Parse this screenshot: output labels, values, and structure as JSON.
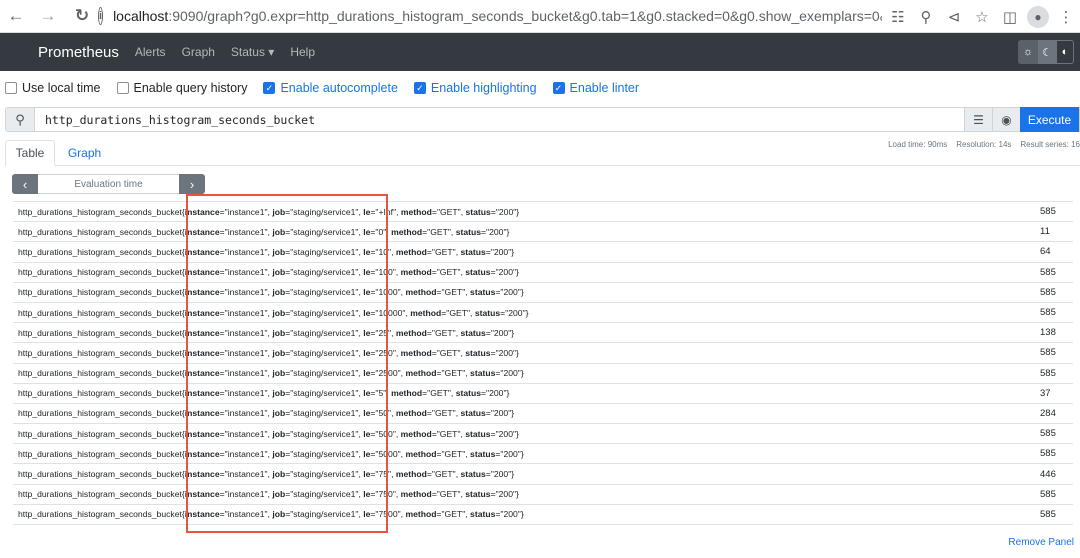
{
  "browser": {
    "url_host": "localhost",
    "url_rest": ":9090/graph?g0.expr=http_durations_histogram_seconds_bucket&g0.tab=1&g0.stacked=0&g0.show_exemplars=0&g0.ran…"
  },
  "navbar": {
    "brand": "Prometheus",
    "links": [
      "Alerts",
      "Graph",
      "Status",
      "Help"
    ]
  },
  "options": [
    {
      "label": "Use local time",
      "checked": false
    },
    {
      "label": "Enable query history",
      "checked": false
    },
    {
      "label": "Enable autocomplete",
      "checked": true
    },
    {
      "label": "Enable highlighting",
      "checked": true
    },
    {
      "label": "Enable linter",
      "checked": true
    }
  ],
  "query": {
    "expression": "http_durations_histogram_seconds_bucket",
    "execute_label": "Execute"
  },
  "tabs": {
    "table": "Table",
    "graph": "Graph"
  },
  "stats": {
    "load_time": "Load time: 90ms",
    "resolution": "Resolution: 14s",
    "result_series": "Result series: 16"
  },
  "eval": {
    "placeholder": "Evaluation time"
  },
  "results": {
    "metric_name": "http_durations_histogram_seconds_bucket",
    "instance": "instance1",
    "job": "staging/service1",
    "method": "GET",
    "status": "200",
    "rows": [
      {
        "le": "+Inf",
        "value": "585"
      },
      {
        "le": "0",
        "value": "11"
      },
      {
        "le": "10",
        "value": "64"
      },
      {
        "le": "100",
        "value": "585"
      },
      {
        "le": "1000",
        "value": "585"
      },
      {
        "le": "10000",
        "value": "585"
      },
      {
        "le": "25",
        "value": "138"
      },
      {
        "le": "250",
        "value": "585"
      },
      {
        "le": "2500",
        "value": "585"
      },
      {
        "le": "5",
        "value": "37"
      },
      {
        "le": "50",
        "value": "284"
      },
      {
        "le": "500",
        "value": "585"
      },
      {
        "le": "5000",
        "value": "585"
      },
      {
        "le": "75",
        "value": "446"
      },
      {
        "le": "750",
        "value": "585"
      },
      {
        "le": "7500",
        "value": "585"
      }
    ]
  },
  "footer": {
    "remove_panel": "Remove Panel"
  },
  "colors": {
    "accent": "#1a73e8",
    "navbar": "#343a40",
    "highlight": "#e8553f"
  }
}
